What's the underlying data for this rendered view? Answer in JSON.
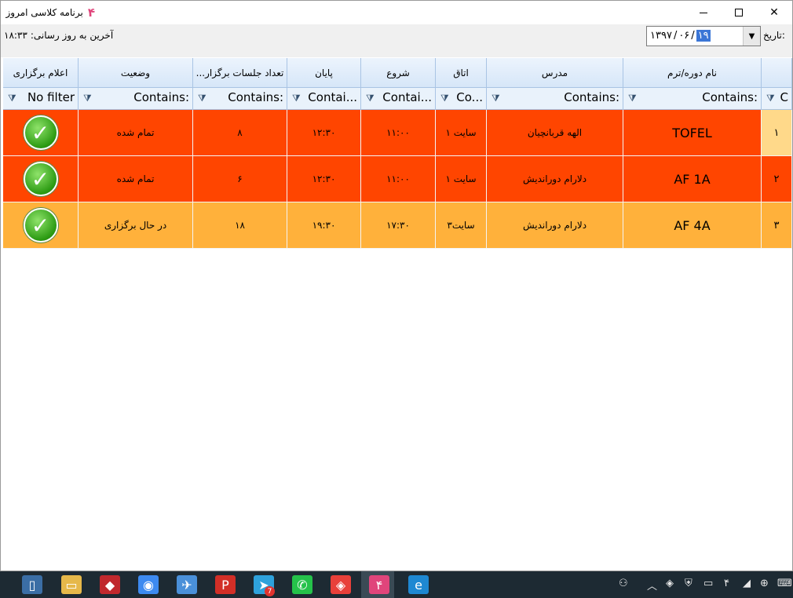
{
  "window": {
    "title": "برنامه کلاسی امروز",
    "logo": "۴"
  },
  "header": {
    "last_update_label": "آخرین به روز رسانی:",
    "last_update_value": "۱۸:۳۳",
    "date_label": "تاریخ:",
    "date_year": "۱۳۹۷",
    "date_month": "۰۶",
    "date_day": "۱۹",
    "date_sep": "/"
  },
  "columns": [
    {
      "key": "rownum",
      "label": ""
    },
    {
      "key": "course",
      "label": "نام دوره/ترم"
    },
    {
      "key": "teacher",
      "label": "مدرس"
    },
    {
      "key": "room",
      "label": "اتاق"
    },
    {
      "key": "start",
      "label": "شروع"
    },
    {
      "key": "end",
      "label": "پایان"
    },
    {
      "key": "sessions",
      "label": "تعداد جلسات برگزار..."
    },
    {
      "key": "status",
      "label": "وضعیت"
    },
    {
      "key": "announce",
      "label": "اعلام برگزاری"
    }
  ],
  "filters": [
    "C",
    "Contains:",
    "Contains:",
    "Co...",
    "Contai...",
    "Contai...",
    "Contains:",
    "Contains:",
    "No filter"
  ],
  "rows": [
    {
      "rownum": "۱",
      "course": "TOFEL",
      "teacher": "الهه قربانچیان",
      "room": "سایت ۱",
      "start": "۱۱:۰۰",
      "end": "۱۲:۳۰",
      "sessions": "۸",
      "status": "تمام شده",
      "announce_icon": "check-icon",
      "color": "#ff4500"
    },
    {
      "rownum": "۲",
      "course": "AF 1A",
      "teacher": "دلارام دوراندیش",
      "room": "سایت ۱",
      "start": "۱۱:۰۰",
      "end": "۱۲:۳۰",
      "sessions": "۶",
      "status": "تمام شده",
      "announce_icon": "check-icon",
      "color": "#ff4500"
    },
    {
      "rownum": "۳",
      "course": "AF 4A",
      "teacher": "دلارام دوراندیش",
      "room": "سایت۳",
      "start": "۱۷:۳۰",
      "end": "۱۹:۳۰",
      "sessions": "۱۸",
      "status": "در حال برگزاری",
      "announce_icon": "check-icon",
      "color": "#ffb13b"
    }
  ],
  "colors": {
    "finished": "#ff4500",
    "in_progress": "#ffb13b",
    "selected_rownum": "#ffd98a",
    "header": "#dbe9f8"
  },
  "taskbar": {
    "icons": [
      "file-explorer-icon",
      "folder-icon",
      "app-red-icon",
      "chrome-icon",
      "bird-app-icon",
      "psiphon-icon",
      "telegram-icon",
      "whatsapp-icon",
      "anydesk-icon",
      "class-app-icon",
      "internet-explorer-icon"
    ],
    "telegram_badge": "7",
    "tray_icons": [
      "people-icon",
      "chevron-up-icon",
      "anydesk-tray-icon",
      "shield-icon",
      "display-icon",
      "class-app-tray-icon",
      "wifi-icon",
      "network-icon",
      "language-icon"
    ]
  }
}
